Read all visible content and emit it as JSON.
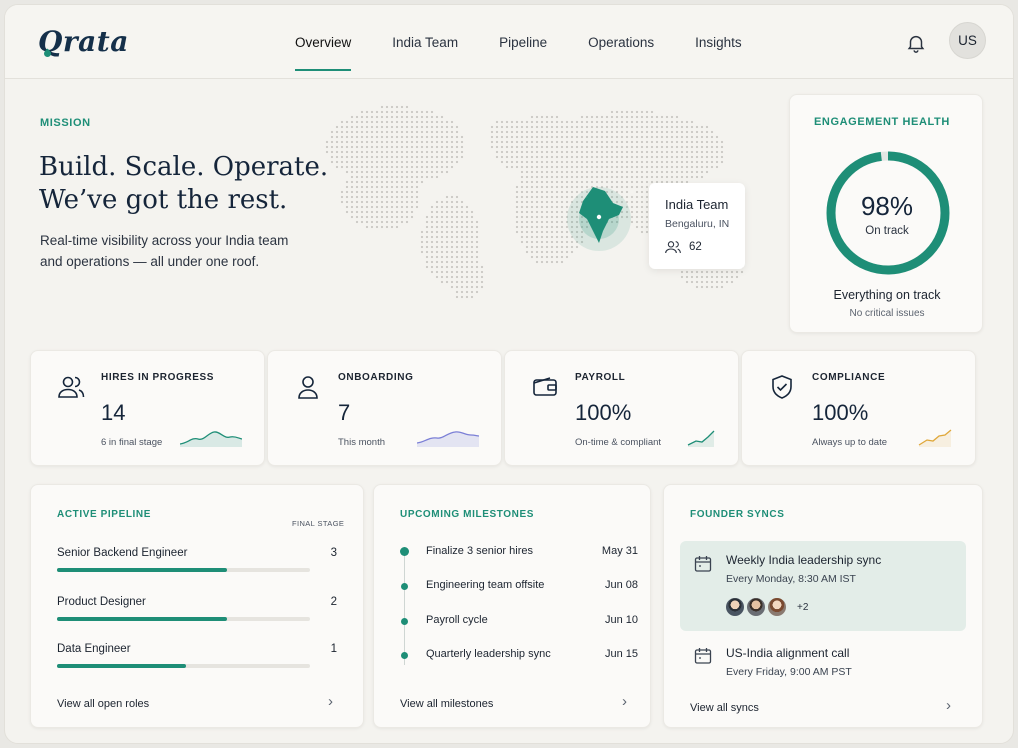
{
  "brand": {
    "logo": "Qrata"
  },
  "nav": {
    "items": [
      {
        "label": "Overview",
        "active": true
      },
      {
        "label": "India Team"
      },
      {
        "label": "Pipeline"
      },
      {
        "label": "Operations"
      },
      {
        "label": "Insights"
      }
    ]
  },
  "header": {
    "avatar": "US",
    "notifications_icon": "bell-icon"
  },
  "hero": {
    "eyebrow": "MISSION",
    "headline_line1": "Build. Scale. Operate.",
    "headline_line2": "We’ve got the rest.",
    "subtext": "Real-time visibility across your India team and operations — all under one roof."
  },
  "map_card": {
    "title": "India Team",
    "location": "Bengaluru, IN",
    "count": "62"
  },
  "health": {
    "eyebrow": "ENGAGEMENT HEALTH",
    "percent": "98%",
    "percent_value": 0.98,
    "label": "On track",
    "message": "Everything on track",
    "sub": "No critical issues"
  },
  "stats": [
    {
      "title": "HIRES IN PROGRESS",
      "value": "14",
      "note": "6 in final stage",
      "icon": "users-icon",
      "color": "#1e8e77"
    },
    {
      "title": "ONBOARDING",
      "value": "7",
      "note": "This month",
      "icon": "user-icon",
      "color": "#7b7fd6"
    },
    {
      "title": "PAYROLL",
      "value": "100%",
      "note": "On-time & compliant",
      "icon": "wallet-icon",
      "color": "#1e8e77"
    },
    {
      "title": "COMPLIANCE",
      "value": "100%",
      "note": "Always up to date",
      "icon": "shield-check-icon",
      "color": "#e0a83a"
    }
  ],
  "pipeline": {
    "title": "ACTIVE PIPELINE",
    "column": "FINAL STAGE",
    "roles": [
      {
        "name": "Senior Backend Engineer",
        "count": "3",
        "progress": 0.67
      },
      {
        "name": "Product Designer",
        "count": "2",
        "progress": 0.67
      },
      {
        "name": "Data Engineer",
        "count": "1",
        "progress": 0.51
      }
    ],
    "footer": "View all open roles"
  },
  "milestones": {
    "title": "UPCOMING MILESTONES",
    "items": [
      {
        "name": "Finalize 3 senior hires",
        "date": "May 31"
      },
      {
        "name": "Engineering team offsite",
        "date": "Jun 08"
      },
      {
        "name": "Payroll cycle",
        "date": "Jun 10"
      },
      {
        "name": "Quarterly leadership sync",
        "date": "Jun 15"
      }
    ],
    "footer": "View all milestones"
  },
  "syncs": {
    "title": "FOUNDER SYNCS",
    "items": [
      {
        "title": "Weekly India leadership sync",
        "when": "Every Monday, 8:30 AM IST",
        "extra": "+2"
      },
      {
        "title": "US-India alignment call",
        "when": "Every Friday, 9:00 AM PST"
      }
    ],
    "footer": "View all syncs"
  },
  "colors": {
    "accent": "#1e8e77",
    "ink": "#15253a",
    "background": "#f4f3ef"
  }
}
